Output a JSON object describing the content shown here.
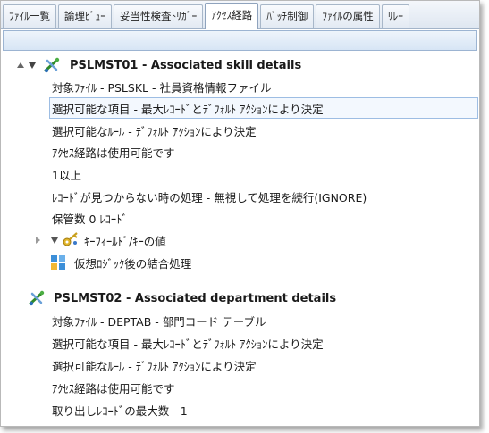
{
  "tabs": [
    {
      "label": "ﾌｧｲﾙ一覧"
    },
    {
      "label": "論理ﾋﾞｭｰ"
    },
    {
      "label": "妥当性検査ﾄﾘｶﾞｰ"
    },
    {
      "label": "ｱｸｾｽ経路"
    },
    {
      "label": "ﾊﾞｯﾁ制御"
    },
    {
      "label": "ﾌｧｲﾙの属性"
    },
    {
      "label": "ﾘﾚｰ"
    }
  ],
  "active_tab": "ｱｸｾｽ経路",
  "groups": [
    {
      "title": "PSLMST01 - Associated skill details",
      "items": [
        "対象ﾌｧｲﾙ - PSLSKL - 社員資格情報ファイル",
        "選択可能な項目 - 最大ﾚｺｰﾄﾞとﾃﾞﾌｫﾙﾄ ｱｸｼｮﾝにより決定",
        "選択可能なﾙｰﾙ - ﾃﾞﾌｫﾙﾄ ｱｸｼｮﾝにより決定",
        "ｱｸｾｽ経路は使用可能です",
        "1以上",
        "ﾚｺｰﾄﾞが見つからない時の処理 - 無視して処理を続行(IGNORE)",
        "保管数 0 ﾚｺｰﾄﾞ"
      ],
      "subnode_label": "ｷｰﾌｨｰﾙﾄﾞ/ｷｰの値",
      "virtual_label": "仮想ﾛｼﾞｯｸ後の結合処理"
    },
    {
      "title": "PSLMST02 - Associated department details",
      "items": [
        "対象ﾌｧｲﾙ - DEPTAB - 部門コード テーブル",
        "選択可能な項目 - 最大ﾚｺｰﾄﾞとﾃﾞﾌｫﾙﾄ ｱｸｼｮﾝにより決定",
        "選択可能なﾙｰﾙ - ﾃﾞﾌｫﾙﾄ ｱｸｼｮﾝにより決定",
        "ｱｸｾｽ経路は使用可能です",
        "取り出しﾚｺｰﾄﾞの最大数 - 1"
      ]
    }
  ],
  "colors": {
    "selection_border": "#9dbde3",
    "selection_fill": "#f3f8fe",
    "tab_border": "#a8b7c9"
  }
}
